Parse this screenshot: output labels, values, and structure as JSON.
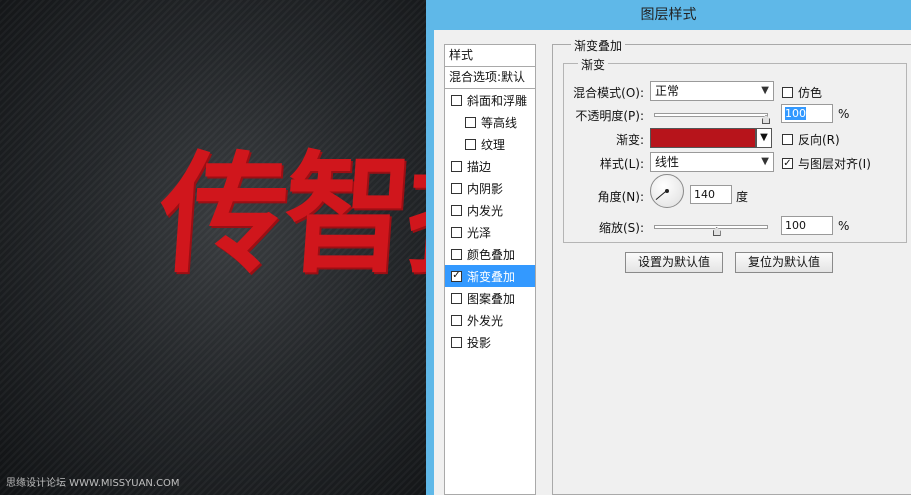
{
  "canvas": {
    "art_text": "传智播",
    "watermark": "思缘设计论坛 WWW.MISSYUAN.COM"
  },
  "dialog": {
    "title": "图层样式",
    "styles_list": {
      "header": "样式",
      "blend_options": "混合选项:默认",
      "items": [
        {
          "label": "斜面和浮雕",
          "checked": false,
          "sub": false
        },
        {
          "label": "等高线",
          "checked": false,
          "sub": true
        },
        {
          "label": "纹理",
          "checked": false,
          "sub": true
        },
        {
          "label": "描边",
          "checked": false,
          "sub": false
        },
        {
          "label": "内阴影",
          "checked": false,
          "sub": false
        },
        {
          "label": "内发光",
          "checked": false,
          "sub": false
        },
        {
          "label": "光泽",
          "checked": false,
          "sub": false
        },
        {
          "label": "颜色叠加",
          "checked": false,
          "sub": false
        },
        {
          "label": "渐变叠加",
          "checked": true,
          "sub": false,
          "selected": true
        },
        {
          "label": "图案叠加",
          "checked": false,
          "sub": false
        },
        {
          "label": "外发光",
          "checked": false,
          "sub": false
        },
        {
          "label": "投影",
          "checked": false,
          "sub": false
        }
      ]
    },
    "gradient_overlay": {
      "section_title": "渐变叠加",
      "group_title": "渐变",
      "blend_mode_label": "混合模式(O):",
      "blend_mode_value": "正常",
      "dither_label": "仿色",
      "dither_checked": false,
      "opacity_label": "不透明度(P):",
      "opacity_value": "100",
      "opacity_percent": 100,
      "percent_sign": "%",
      "gradient_label": "渐变:",
      "gradient_color": "#b7141b",
      "reverse_label": "反向(R)",
      "reverse_checked": false,
      "style_label": "样式(L):",
      "style_value": "线性",
      "align_label": "与图层对齐(I)",
      "align_checked": true,
      "angle_label": "角度(N):",
      "angle_value": "140",
      "angle_unit": "度",
      "scale_label": "缩放(S):",
      "scale_value": "100",
      "scale_percent": 100,
      "scale_percent_sign": "%",
      "set_default_button": "设置为默认值",
      "reset_default_button": "复位为默认值"
    }
  },
  "colors": {
    "titlebar": "#5fb8e8",
    "selected": "#3399ff",
    "art_red": "#d0161c"
  }
}
